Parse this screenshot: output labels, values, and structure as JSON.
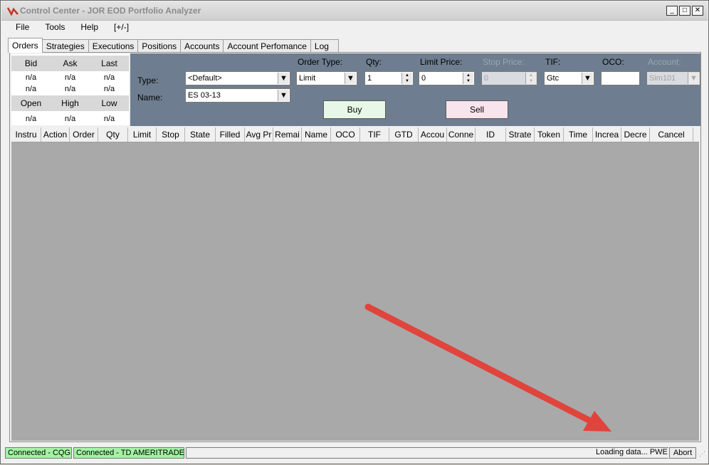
{
  "window": {
    "title": "Control Center - JOR EOD Portfolio Analyzer"
  },
  "menu": [
    "File",
    "Tools",
    "Help",
    "[+/-]"
  ],
  "tabs": [
    "Orders",
    "Strategies",
    "Executions",
    "Positions",
    "Accounts",
    "Account Perfomance",
    "Log"
  ],
  "quote": {
    "headers1": [
      "Bid",
      "Ask",
      "Last"
    ],
    "row1": [
      "n/a",
      "n/a",
      "n/a"
    ],
    "row2": [
      "n/a",
      "n/a",
      "n/a"
    ],
    "headers2": [
      "Open",
      "High",
      "Low"
    ],
    "row3": [
      "n/a",
      "n/a",
      "n/a"
    ]
  },
  "entry": {
    "type_label": "Type:",
    "type_value": "<Default>",
    "name_label": "Name:",
    "name_value": "ES 03-13",
    "order_type_label": "Order Type:",
    "order_type_value": "Limit",
    "qty_label": "Qty:",
    "qty_value": "1",
    "limit_price_label": "Limit Price:",
    "limit_price_value": "0",
    "stop_price_label": "Stop Price:",
    "stop_price_value": "0",
    "tif_label": "TIF:",
    "tif_value": "Gtc",
    "oco_label": "OCO:",
    "account_label": "Account:",
    "account_value": "Sim101",
    "buy_label": "Buy",
    "sell_label": "Sell"
  },
  "columns": [
    "Instru",
    "Action",
    "Order",
    "Qty",
    "Limit",
    "Stop",
    "State",
    "Filled",
    "Avg Pr",
    "Remai",
    "Name",
    "OCO",
    "TIF",
    "GTD",
    "Accou",
    "Conne",
    "ID",
    "Strate",
    "Token",
    "Time",
    "Increa",
    "Decre",
    "Cancel"
  ],
  "status": {
    "conn1": "Connected - CQG",
    "conn2": "Connected - TD AMERITRADE",
    "loading": "Loading data... PWE",
    "abort": "Abort"
  },
  "colors": {
    "entry_bg": "#6e7e90",
    "grid_bg": "#a9a9a9",
    "buy_bg": "#e8f8e8",
    "sell_bg": "#f8e4ec",
    "connected": "#a4f2a4",
    "arrow": "#e0443c"
  }
}
